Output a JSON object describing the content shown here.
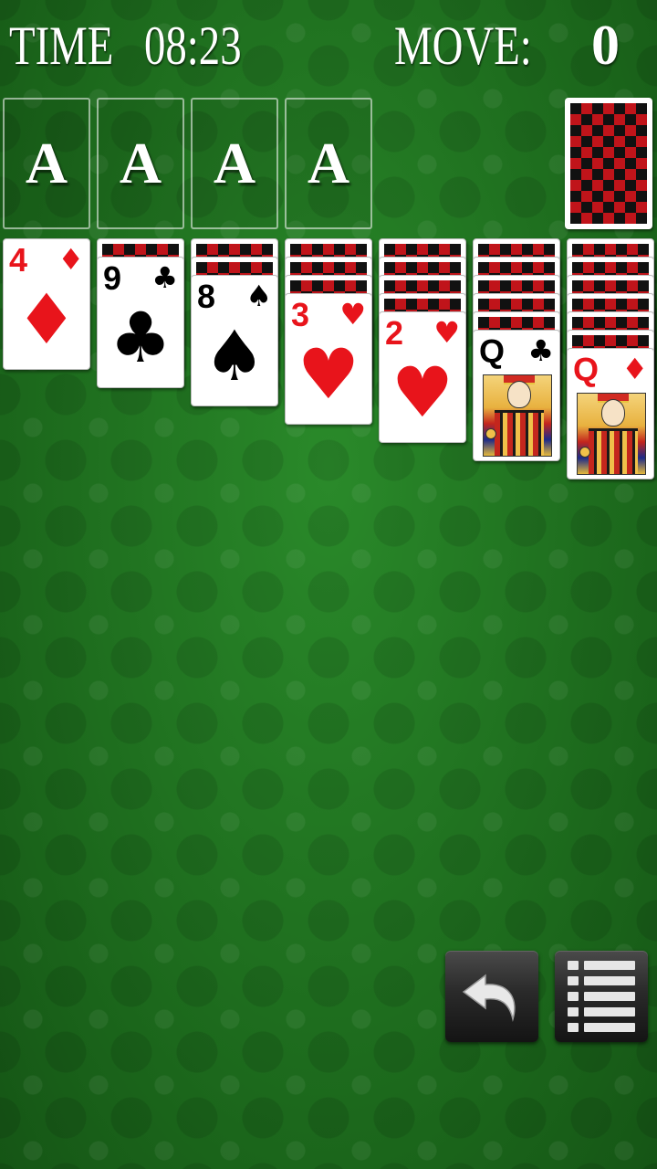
{
  "hud": {
    "time_label": "TIME",
    "time_value": "08:23",
    "move_label": "MOVE:",
    "move_value": "0"
  },
  "foundations": [
    {
      "label": "A"
    },
    {
      "label": "A"
    },
    {
      "label": "A"
    },
    {
      "label": "A"
    }
  ],
  "stock": {
    "back_pattern": "red-black-checker"
  },
  "tableau": [
    {
      "hidden_count": 0,
      "top": {
        "rank": "4",
        "suit": "♦",
        "color": "red"
      }
    },
    {
      "hidden_count": 1,
      "top": {
        "rank": "9",
        "suit": "♣",
        "color": "black"
      }
    },
    {
      "hidden_count": 2,
      "top": {
        "rank": "8",
        "suit": "♠",
        "color": "black"
      }
    },
    {
      "hidden_count": 3,
      "top": {
        "rank": "3",
        "suit": "♥",
        "color": "red"
      }
    },
    {
      "hidden_count": 4,
      "top": {
        "rank": "2",
        "suit": "♥",
        "color": "red"
      }
    },
    {
      "hidden_count": 5,
      "top": {
        "rank": "Q",
        "suit": "♣",
        "color": "black"
      }
    },
    {
      "hidden_count": 6,
      "top": {
        "rank": "Q",
        "suit": "♦",
        "color": "red"
      }
    }
  ],
  "controls": {
    "undo_icon": "undo-arrow-icon",
    "menu_icon": "menu-list-icon"
  },
  "colors": {
    "felt": "#1f6b1f",
    "card_back_red": "#c0141a",
    "suit_red": "#e8141b"
  }
}
